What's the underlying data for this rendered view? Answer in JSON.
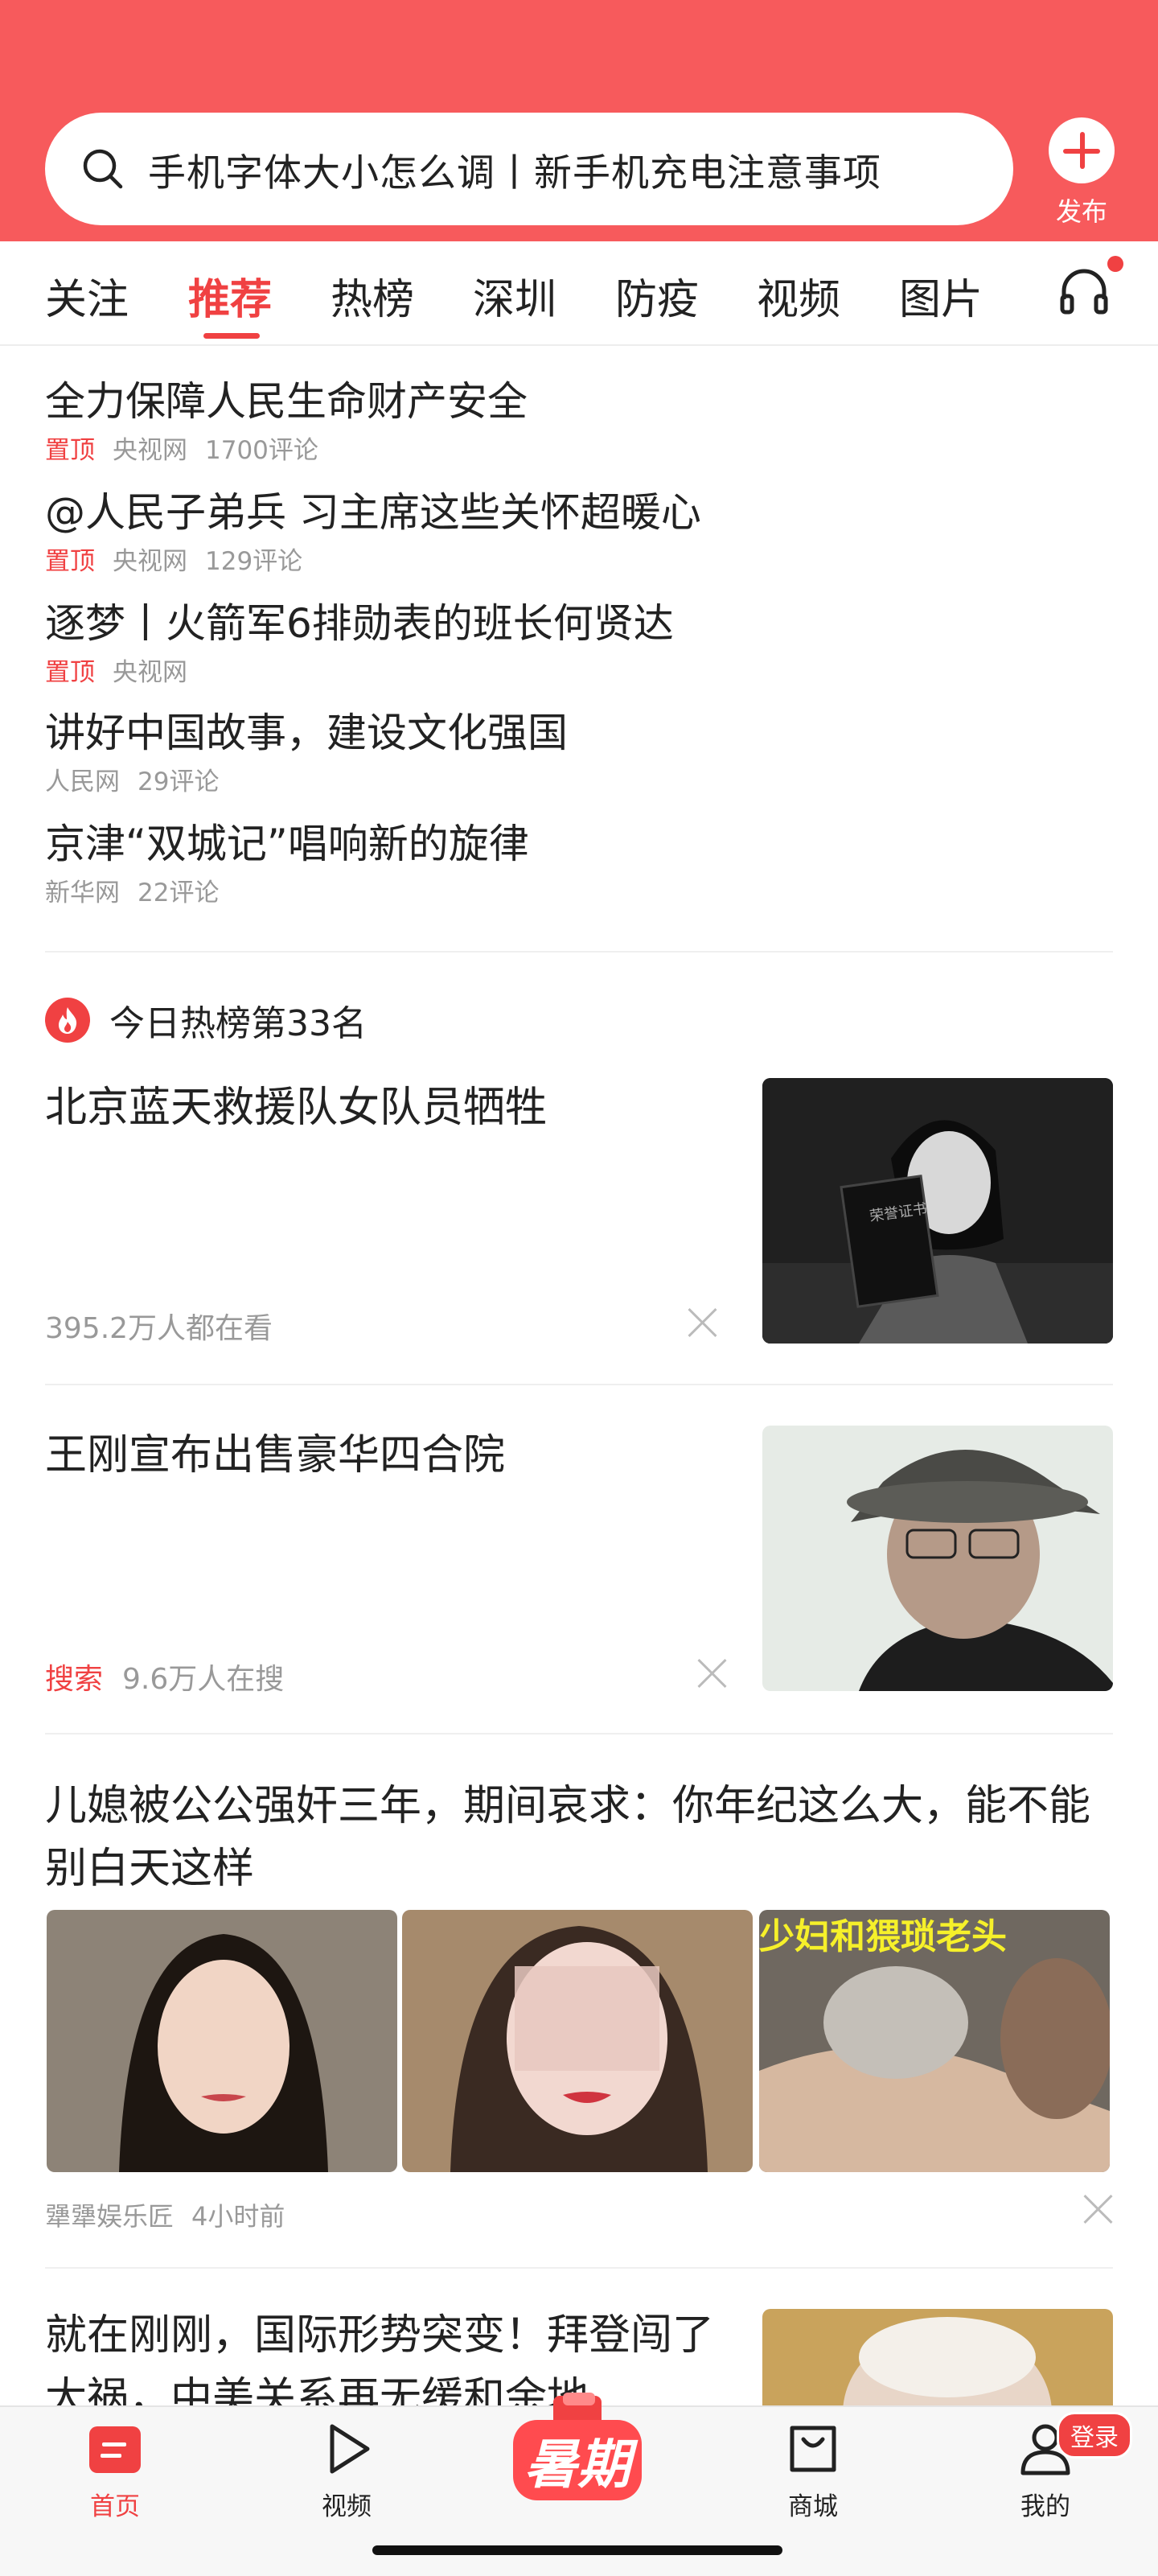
{
  "header": {
    "search_text": "手机字体大小怎么调丨新手机充电注意事项",
    "publish_label": "发布"
  },
  "tabs": [
    {
      "label": "关注"
    },
    {
      "label": "推荐",
      "active": true
    },
    {
      "label": "热榜"
    },
    {
      "label": "深圳"
    },
    {
      "label": "防疫"
    },
    {
      "label": "视频"
    },
    {
      "label": "图片"
    }
  ],
  "pinned": [
    {
      "title": "全力保障人民生命财产安全",
      "tag": "置顶",
      "source": "央视网",
      "comments": "1700评论"
    },
    {
      "title": "@人民子弟兵 习主席这些关怀超暖心",
      "tag": "置顶",
      "source": "央视网",
      "comments": "129评论"
    },
    {
      "title": "逐梦丨火箭军6排勋表的班长何贤达",
      "tag": "置顶",
      "source": "央视网",
      "comments": ""
    },
    {
      "title": "讲好中国故事，建设文化强国",
      "tag": "",
      "source": "人民网",
      "comments": "29评论"
    },
    {
      "title": "京津“双城记”唱响新的旋律",
      "tag": "",
      "source": "新华网",
      "comments": "22评论"
    }
  ],
  "hot": {
    "label": "今日热榜第33名"
  },
  "feed": [
    {
      "title": "北京蓝天救援队女队员牺牲",
      "meta": "395.2万人都在看",
      "thumb_text": "荣誉证书"
    },
    {
      "title": "王刚宣布出售豪华四合院",
      "tag": "搜索",
      "meta": "9.6万人在搜"
    },
    {
      "title": "儿媳被公公强奸三年，期间哀求：你年纪这么大，能不能别白天这样",
      "source": "犟犟娱乐匠",
      "time": "4小时前",
      "image_caption": "少妇和猥琐老头"
    },
    {
      "title": "就在刚刚，国际形势突变！拜登闯了大祸，中美关系再无缓和余地"
    }
  ],
  "bottom_nav": [
    {
      "label": "首页",
      "icon": "home-icon",
      "active": true
    },
    {
      "label": "视频",
      "icon": "play-icon"
    },
    {
      "label": "暑期",
      "icon": "summer-promo-icon"
    },
    {
      "label": "商城",
      "icon": "shopping-bag-icon"
    },
    {
      "label": "我的",
      "icon": "user-icon",
      "badge": "登录"
    }
  ],
  "colors": {
    "accent": "#f04142",
    "header_bg": "#f75a5c"
  }
}
